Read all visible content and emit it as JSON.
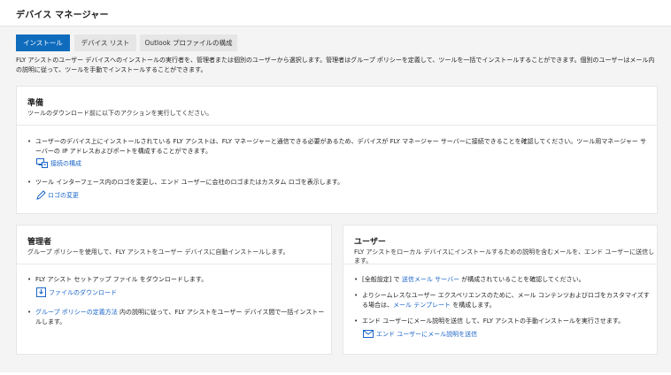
{
  "header": {
    "title": "デバイス マネージャー"
  },
  "tabs": [
    {
      "label": "インストール",
      "active": true
    },
    {
      "label": "デバイス リスト",
      "active": false
    },
    {
      "label": "Outlook プロファイルの構成",
      "active": false
    }
  ],
  "description": "FLY アシストのユーザー デバイスへのインストールの実行者を、管理者または個別のユーザーから選択します。管理者はグループ ポリシーを定義して、ツールを一括でインストールすることができます。個別のユーザーはメール内の説明に従って、ツールを手動でインストールすることができます。",
  "prep": {
    "title": "準備",
    "subtitle": "ツールのダウンロード前に以下のアクションを実行してください。",
    "item1_text": "ユーザーのデバイス上にインストールされている FLY アシストは、FLY マネージャーと通信できる必要があるため、デバイスが FLY マネージャー サーバーに接続できることを確認してください。ツール用マネージャー サーバーの IP アドレスおよびポートを構成することができます。",
    "item1_action": "接続の構成",
    "item2_text": "ツール インターフェース内のロゴを変更し、エンド ユーザーに会社のロゴまたはカスタム ロゴを表示します。",
    "item2_action": "ロゴの変更"
  },
  "admin": {
    "title": "管理者",
    "subtitle": "グループ ポリシーを使用して、FLY アシストをユーザー デバイスに自動インストールします。",
    "item1_text": "FLY アシスト セットアップ ファイル をダウンロードします。",
    "item1_action": "ファイルのダウンロード",
    "item2_link": "グループ ポリシーの定義方法",
    "item2_text": " 内の説明に従って、FLY アシストをユーザー デバイス間で一括インストールします。"
  },
  "user": {
    "title": "ユーザー",
    "subtitle": "FLY アシストをローカル デバイスにインストールするための説明を含むメールを、エンド ユーザーに送信します。",
    "item1_pre": "[全般設定] で ",
    "item1_link": "送信メール サーバー",
    "item1_post": " が構成されていることを確認してください。",
    "item2_pre": "よりシームレスなユーザー エクスペリエンスのために、メール コンテンツおよびロゴをカスタマイズする場合は、",
    "item2_link": "メール テンプレート",
    "item2_post": " を構成します。",
    "item3_text": "エンド ユーザーにメール説明を送信 して、FLY アシストの手動インストールを実行させます。",
    "item3_action": "エンド ユーザーにメール説明を送信"
  },
  "colors": {
    "accent": "#0f6cbd",
    "link": "#1a64c8",
    "background": "#f4f4f4"
  }
}
